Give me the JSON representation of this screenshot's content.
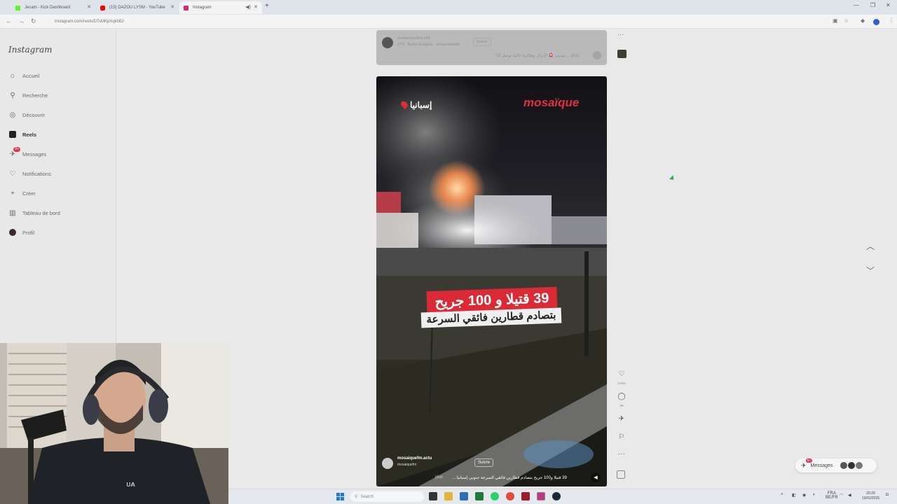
{
  "tabs": [
    {
      "label": "Jecam - Kick Dashboard",
      "favicon_color": "#53fc18"
    },
    {
      "label": "(15) DAZOU LYSM - YouTube",
      "favicon_color": "#ff0000"
    },
    {
      "label": "Instagram",
      "favicon_color": "#d62976"
    }
  ],
  "address": {
    "url": "instagram.com/reels/DTsMKpXqkND/"
  },
  "sidebar": {
    "logo": "Instagram",
    "items": [
      {
        "label": "Accueil",
        "icon": "home-icon"
      },
      {
        "label": "Recherche",
        "icon": "search-icon"
      },
      {
        "label": "Découvrir",
        "icon": "compass-icon"
      },
      {
        "label": "Reels",
        "icon": "reels-icon"
      },
      {
        "label": "Messages",
        "icon": "messenger-icon",
        "badge": "9+"
      },
      {
        "label": "Notifications",
        "icon": "heart-icon"
      },
      {
        "label": "Créer",
        "icon": "plus-icon"
      },
      {
        "label": "Tableau de bord",
        "icon": "dashboard-icon"
      },
      {
        "label": "Profil",
        "icon": "profile-icon"
      }
    ]
  },
  "prev_reel": {
    "username": "mohammedlas.off9",
    "sub": "ZT3 · Audio d'origine · mohammedtn",
    "follow": "Suivre",
    "caption": "بسبب 🚨 الإنزال وطائرة عالية توصل 10 ... plus"
  },
  "reel": {
    "location": "إسبانيا",
    "brand": "mosaïque",
    "headline_1": "39 قتيلا و 100 جريح",
    "headline_2": "بتصادم قطارين فائقي السرعة",
    "username": "mosaiquefm.actu",
    "sub": "mosaiquefm",
    "follow": "Suivre",
    "caption": "39 قتيلا و100 جريح بتصادم قطارين فائقي السرعة جنوبي إسبانيا ...",
    "more": "plus",
    "like_count": "3 644",
    "comment_count": "39"
  },
  "messages_pill": {
    "label": "Messages",
    "badge": "9+"
  },
  "taskbar": {
    "search": "Search",
    "lang": "FRA",
    "region": "BE/FR",
    "time": "20:29",
    "date": "19/01/2026"
  },
  "colors": {
    "badge": "#e8344a",
    "brand_red": "#e03040",
    "headline_bg": "#d92a36",
    "accent_blue": "#1e78d6"
  }
}
